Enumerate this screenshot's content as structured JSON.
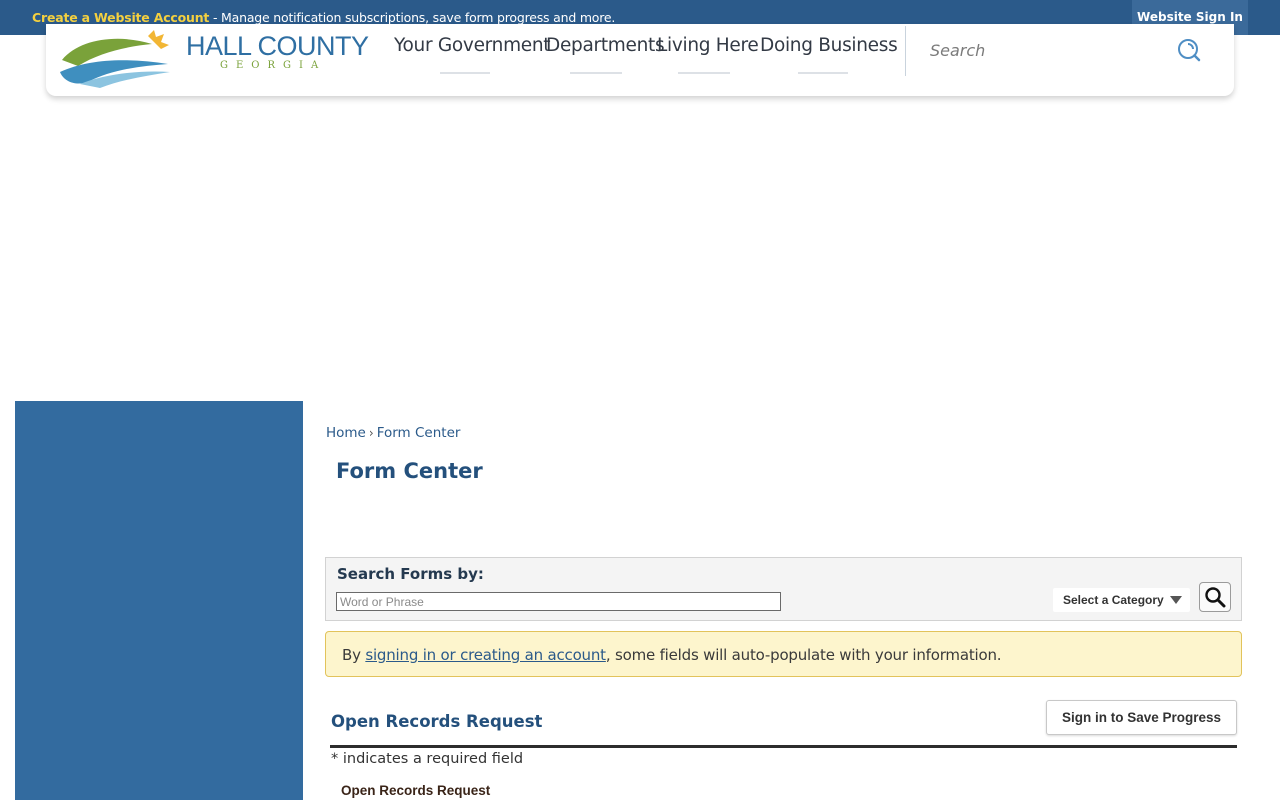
{
  "topbar": {
    "create_account_link": "Create a Website Account",
    "message": " - Manage notification subscriptions, save form progress and more.",
    "signin_label": "Website Sign In"
  },
  "header": {
    "brand_name": "HALL COUNTY",
    "brand_sub": "GEORGIA",
    "nav": [
      {
        "label": "Your Government"
      },
      {
        "label": "Departments"
      },
      {
        "label": "Living Here"
      },
      {
        "label": "Doing Business"
      }
    ],
    "search": {
      "placeholder": "Search",
      "icon": "search-icon"
    }
  },
  "breadcrumb": {
    "home": "Home",
    "separator": "›",
    "current": "Form Center"
  },
  "page": {
    "title": "Form Center"
  },
  "form_search": {
    "label": "Search Forms by:",
    "input_placeholder": "Word or Phrase",
    "category_label": "Select a Category",
    "button_icon": "search-icon"
  },
  "notice": {
    "prefix": "By ",
    "link": "signing in or creating an account",
    "suffix": ", some fields will auto-populate with your information."
  },
  "form": {
    "title": "Open Records Request",
    "save_button": "Sign in to Save Progress",
    "required_note": "* indicates a required field",
    "first_field_label": "Open Records Request"
  },
  "colors": {
    "topbar_bg": "#2b5a8a",
    "create_link": "#f4d03f",
    "sidebar_bg": "#336b9f",
    "heading_blue": "#24507c",
    "notice_bg": "#fdf5cd"
  }
}
